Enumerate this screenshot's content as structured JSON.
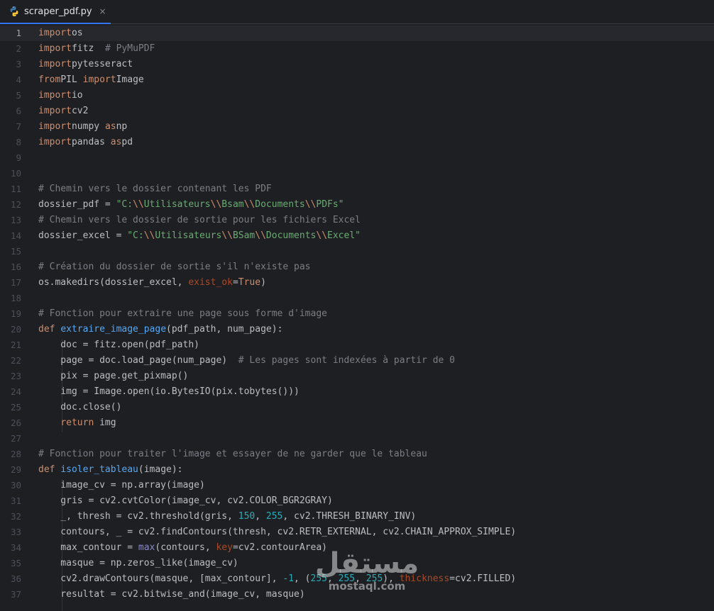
{
  "tab": {
    "file_name": "scraper_pdf.py",
    "close_glyph": "×",
    "icon": "python-file-icon"
  },
  "colors": {
    "keyword": "#cf8e6d",
    "comment": "#7a7e85",
    "string": "#6aab73",
    "function": "#56a8f5",
    "number": "#2aacb8",
    "kwarg": "#aa4926",
    "builtin": "#8888c6",
    "default": "#bcbec4",
    "background": "#1e1f22",
    "tab_accent": "#3574f0"
  },
  "editor": {
    "current_line": 1,
    "lines": [
      [
        [
          "kw",
          "import"
        ],
        [
          "",
          "os"
        ]
      ],
      [
        [
          "kw",
          "import"
        ],
        [
          "",
          "fitz  "
        ],
        [
          "cm",
          "# PyMuPDF"
        ]
      ],
      [
        [
          "kw",
          "import"
        ],
        [
          "",
          "pytesseract"
        ]
      ],
      [
        [
          "kw",
          "from"
        ],
        [
          "",
          "PIL "
        ],
        [
          "kw",
          "import"
        ],
        [
          "",
          "Image"
        ]
      ],
      [
        [
          "kw",
          "import"
        ],
        [
          "",
          "io"
        ]
      ],
      [
        [
          "kw",
          "import"
        ],
        [
          "",
          "cv2"
        ]
      ],
      [
        [
          "kw",
          "import"
        ],
        [
          "",
          "numpy "
        ],
        [
          "kw",
          "as"
        ],
        [
          "",
          "np"
        ]
      ],
      [
        [
          "kw",
          "import"
        ],
        [
          "",
          "pandas "
        ],
        [
          "kw",
          "as"
        ],
        [
          "",
          "pd"
        ]
      ],
      [],
      [],
      [
        [
          "cm",
          "# Chemin vers le dossier contenant les PDF"
        ]
      ],
      [
        [
          "",
          "dossier_pdf = "
        ],
        [
          "str",
          "\"C:"
        ],
        [
          "esc",
          "\\\\"
        ],
        [
          "str",
          "Utilisateurs"
        ],
        [
          "esc",
          "\\\\"
        ],
        [
          "str",
          "Bsam"
        ],
        [
          "esc",
          "\\\\"
        ],
        [
          "str",
          "Documents"
        ],
        [
          "esc",
          "\\\\"
        ],
        [
          "str",
          "PDFs\""
        ]
      ],
      [
        [
          "cm",
          "# Chemin vers le dossier de sortie pour les fichiers Excel"
        ]
      ],
      [
        [
          "",
          "dossier_excel = "
        ],
        [
          "str",
          "\"C:"
        ],
        [
          "esc",
          "\\\\"
        ],
        [
          "str",
          "Utilisateurs"
        ],
        [
          "esc",
          "\\\\"
        ],
        [
          "str",
          "BSam"
        ],
        [
          "esc",
          "\\\\"
        ],
        [
          "str",
          "Documents"
        ],
        [
          "esc",
          "\\\\"
        ],
        [
          "str",
          "Excel\""
        ]
      ],
      [],
      [
        [
          "cm",
          "# Création du dossier de sortie s'il n'existe pas"
        ]
      ],
      [
        [
          "",
          "os.makedirs(dossier_excel, "
        ],
        [
          "kwarg",
          "exist_ok"
        ],
        [
          "",
          "="
        ],
        [
          "kw",
          "True"
        ],
        [
          "",
          ")"
        ]
      ],
      [],
      [
        [
          "cm",
          "# Fonction pour extraire une page sous forme d'image"
        ]
      ],
      [
        [
          "kw",
          "def "
        ],
        [
          "fn",
          "extraire_image_page"
        ],
        [
          "",
          "(pdf_path, num_page):"
        ]
      ],
      [
        [
          "",
          "    doc = fitz.open(pdf_path)"
        ]
      ],
      [
        [
          "",
          "    page = doc.load_page(num_page)  "
        ],
        [
          "cm",
          "# Les pages sont indexées à partir de 0"
        ]
      ],
      [
        [
          "",
          "    pix = page.get_pixmap()"
        ]
      ],
      [
        [
          "",
          "    img = Image.open(io.BytesIO(pix.tobytes()))"
        ]
      ],
      [
        [
          "",
          "    doc.close()"
        ]
      ],
      [
        [
          "kw",
          "    return"
        ],
        [
          "",
          " img"
        ]
      ],
      [],
      [
        [
          "cm",
          "# Fonction pour traiter l'image et essayer de ne garder que le tableau"
        ]
      ],
      [
        [
          "kw",
          "def "
        ],
        [
          "fn",
          "isoler_tableau"
        ],
        [
          "",
          "(image):"
        ]
      ],
      [
        [
          "",
          "    image_cv = np.array(image)"
        ]
      ],
      [
        [
          "",
          "    gris = cv2.cvtColor(image_cv, cv2.COLOR_BGR2GRAY)"
        ]
      ],
      [
        [
          "",
          "    _, thresh = cv2.threshold(gris, "
        ],
        [
          "num",
          "150"
        ],
        [
          "",
          ", "
        ],
        [
          "num",
          "255"
        ],
        [
          "",
          ", cv2.THRESH_BINARY_INV)"
        ]
      ],
      [
        [
          "",
          "    contours, _ = cv2.findContours(thresh, cv2.RETR_EXTERNAL, cv2.CHAIN_APPROX_SIMPLE)"
        ]
      ],
      [
        [
          "",
          "    max_contour = "
        ],
        [
          "bi",
          "max"
        ],
        [
          "",
          "(contours, "
        ],
        [
          "kwarg",
          "key"
        ],
        [
          "",
          "=cv2.contourArea)"
        ]
      ],
      [
        [
          "",
          "    masque = np.zeros_like(image_cv)"
        ]
      ],
      [
        [
          "",
          "    cv2.drawContours(masque, [max_contour], "
        ],
        [
          "num",
          "-1"
        ],
        [
          "",
          ", ("
        ],
        [
          "num",
          "255"
        ],
        [
          "",
          ", "
        ],
        [
          "num",
          "255"
        ],
        [
          "",
          ", "
        ],
        [
          "num",
          "255"
        ],
        [
          "",
          "), "
        ],
        [
          "kwarg",
          "thickness"
        ],
        [
          "",
          "=cv2.FILLED)"
        ]
      ],
      [
        [
          "",
          "    resultat = cv2.bitwise_and(image_cv, masque)"
        ]
      ]
    ]
  },
  "watermark": {
    "logo_text": "مستقل",
    "site": "mostaql.com"
  }
}
